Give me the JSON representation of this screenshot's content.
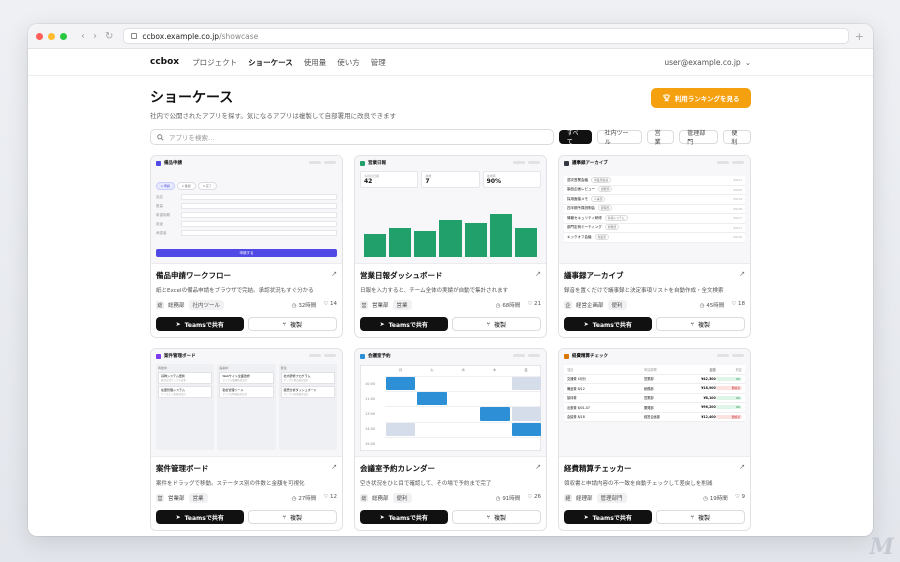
{
  "browser": {
    "url_host": "ccbox.example.co.jp",
    "url_path": "/showcase",
    "colors": {
      "close": "#ff5f57",
      "minimize": "#febc2e",
      "zoom": "#28c840"
    }
  },
  "nav": {
    "logo": "ccbox",
    "items": [
      "プロジェクト",
      "ショーケース",
      "使用量",
      "使い方",
      "管理"
    ],
    "active": "ショーケース",
    "user_email": "user@example.co.jp"
  },
  "page": {
    "title": "ショーケース",
    "subtitle": "社内で公開されたアプリを探す。気になるアプリは複製して自部署用に改良できます",
    "ranking_button": "利用ランキングを見る",
    "search_placeholder": "アプリを検索…",
    "filters": [
      "すべて",
      "社内ツール",
      "営業",
      "管理部門",
      "便利"
    ],
    "active_filter": "すべて"
  },
  "actions": {
    "share": "Teamsで共有",
    "copy": "複製"
  },
  "cards": [
    {
      "preview_title": "備品申請",
      "accent": "#5049e5",
      "steps": [
        "1 申請",
        "2 確認",
        "3 完了"
      ],
      "fields": [
        "品名",
        "数量",
        "希望納期",
        "用途",
        "承認者"
      ],
      "submit": "申請する",
      "title": "備品申請ワークフロー",
      "desc": "紙とExcelの備品申請をブラウザで完結。承認状況もすぐ分かる",
      "dept_icon": "総",
      "dept": "総務部",
      "tag": "社内ツール",
      "time": "32時間",
      "likes": "14"
    },
    {
      "preview_title": "営業日報",
      "accent": "#22a06b",
      "kpis": [
        {
          "k": "今月の日報",
          "v": "42"
        },
        {
          "k": "商談",
          "v": "7"
        },
        {
          "k": "達成率",
          "v": "90%"
        }
      ],
      "chart_data": {
        "type": "bar",
        "values": [
          45,
          55,
          50,
          72,
          66,
          82,
          56
        ],
        "ylim": [
          0,
          100
        ]
      },
      "title": "営業日報ダッシュボード",
      "desc": "日報を入力すると、チーム全体の実績が自動で集計されます",
      "dept_icon": "営",
      "dept": "営業部",
      "tag": "営業",
      "time": "68時間",
      "likes": "21"
    },
    {
      "preview_title": "議事録アーカイブ",
      "accent": "#333842",
      "docs": [
        {
          "t": "週次営業会議",
          "b": "営業部会議",
          "d": "05/21"
        },
        {
          "t": "製品企画レビュー",
          "b": "開発部",
          "d": "05/20"
        },
        {
          "t": "採用面接メモ",
          "b": "人事部",
          "d": "05/19"
        },
        {
          "t": "四半期予算説明会",
          "b": "経理部",
          "d": "05/18"
        },
        {
          "t": "情報セキュリティ研修",
          "b": "情報システム",
          "d": "05/17"
        },
        {
          "t": "部門定例ミーティング",
          "b": "総務部",
          "d": "05/17"
        },
        {
          "t": "キックオフ会議",
          "b": "営業部",
          "d": "05/16"
        }
      ],
      "title": "議事録アーカイブ",
      "desc": "録音を置くだけで議事録と決定事項リストを自動作成・全文検索",
      "dept_icon": "企",
      "dept": "経営企画部",
      "tag": "便利",
      "time": "45時間",
      "likes": "18"
    },
    {
      "preview_title": "案件管理ボード",
      "accent": "#7c3aed",
      "columns": [
        {
          "h": "商談中",
          "items": [
            {
              "t": "基幹システム更新",
              "s": "株式会社サンプル商事"
            },
            {
              "t": "在庫管理システム",
              "s": "サンプル工業株式会社"
            }
          ]
        },
        {
          "h": "提案中",
          "items": [
            {
              "t": "Webサイト全面改修",
              "s": "サンプル電機株式会社"
            },
            {
              "t": "勤怠管理ツール",
              "s": "サンプル物流株式会社"
            }
          ]
        },
        {
          "h": "受注",
          "items": [
            {
              "t": "社内研修プログラム",
              "s": "サンプル食品株式会社"
            },
            {
              "t": "販売分析ダッシュボード",
              "s": "サンプル産業株式会社"
            }
          ]
        }
      ],
      "title": "案件管理ボード",
      "desc": "案件をドラッグで移動。ステータス別の件数と金額を可視化",
      "dept_icon": "営",
      "dept": "営業部",
      "tag": "営業",
      "time": "27時間",
      "likes": "12"
    },
    {
      "preview_title": "会議室予約",
      "accent": "#2d8fd5",
      "days": [
        "月",
        "火",
        "水",
        "木",
        "金"
      ],
      "times": [
        "10:00",
        "11:00",
        "13:00",
        "14:00",
        "15:00"
      ],
      "title": "会議室予約カレンダー",
      "desc": "空き状況をひと目で確認して、その場で予約まで完了",
      "dept_icon": "総",
      "dept": "総務部",
      "tag": "便利",
      "time": "91時間",
      "likes": "26"
    },
    {
      "preview_title": "経費精算チェック",
      "accent": "#d97706",
      "header": [
        "項目",
        "申請部署",
        "金額",
        "判定"
      ],
      "rows": [
        {
          "a": "交通費 4月分",
          "b": "営業部",
          "c": "¥42,300",
          "s": "OK",
          "ok": true
        },
        {
          "a": "備品費 8/12",
          "b": "総務部",
          "c": "¥18,900",
          "s": "要確認",
          "ok": false
        },
        {
          "a": "接待費",
          "b": "営業部",
          "c": "¥8,100",
          "s": "OK",
          "ok": true
        },
        {
          "a": "出張費 8/01-07",
          "b": "開発部",
          "c": "¥96,200",
          "s": "OK",
          "ok": true
        },
        {
          "a": "会議費 8/18",
          "b": "経営企画部",
          "c": "¥12,400",
          "s": "要確認",
          "ok": false
        }
      ],
      "title": "経費精算チェッカー",
      "desc": "領収書と申請内容の不一致を自動チェックして差戻しを削減",
      "dept_icon": "経",
      "dept": "経理部",
      "tag": "管理部門",
      "time": "19時間",
      "likes": "9"
    }
  ]
}
